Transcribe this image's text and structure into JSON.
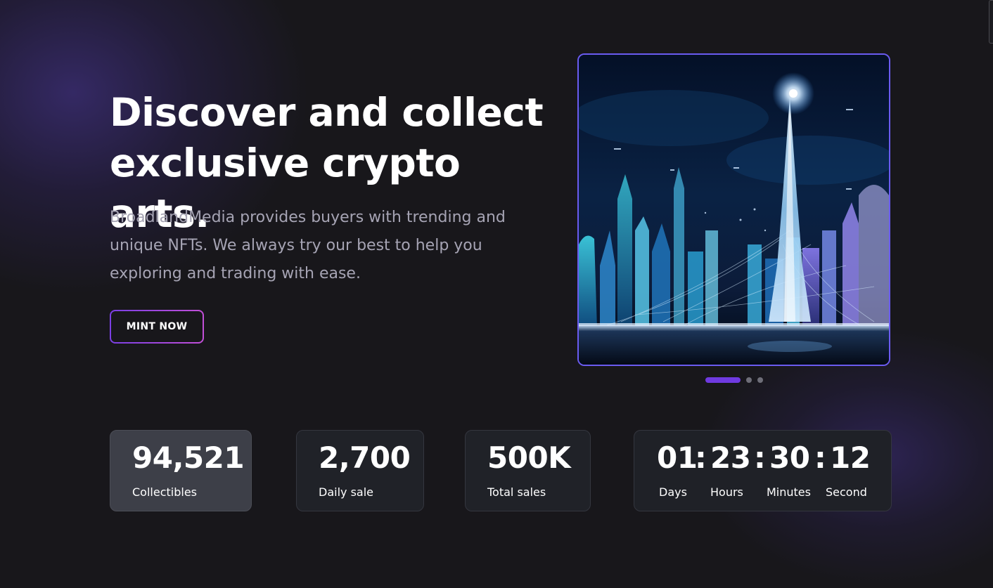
{
  "hero": {
    "title_line1": "Discover and collect",
    "title_line2": "exclusive crypto arts.",
    "description": "BroadlandMedia provides buyers with trending and unique NFTs. We always try our best to help you exploring and trading with ease.",
    "cta_label": "MINT NOW"
  },
  "carousel": {
    "active_index": 0,
    "slide_count": 3
  },
  "stats": [
    {
      "value": "94,521",
      "label": "Collectibles"
    },
    {
      "value": "2,700",
      "label": "Daily sale"
    },
    {
      "value": "500K",
      "label": "Total sales"
    }
  ],
  "countdown": {
    "days": "01",
    "hours": "23",
    "minutes": "30",
    "seconds": "12",
    "separator": ":",
    "days_label": "Days",
    "hours_label": "Hours",
    "minutes_label": "Minutes",
    "seconds_label": "Second"
  },
  "colors": {
    "background": "#18171b",
    "accent": "#6f3ae0",
    "button_gradient_start": "#7b3fe4",
    "button_gradient_end": "#c24fd8",
    "card": "#202228",
    "card_highlight": "#3d3f48",
    "muted_text": "#a6a4b4"
  }
}
